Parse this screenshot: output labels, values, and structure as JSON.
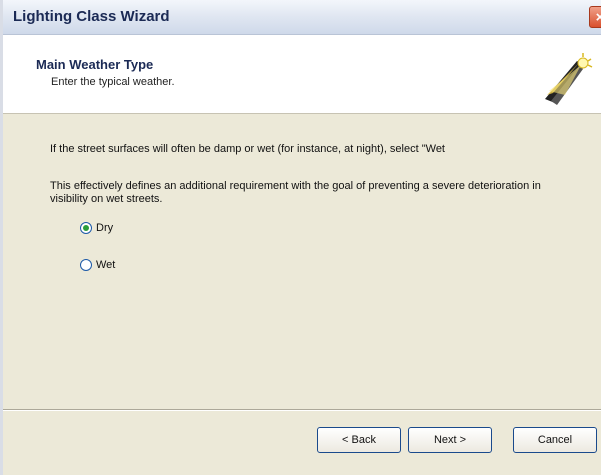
{
  "window": {
    "title": "Lighting Class Wizard",
    "close_symbol": "×"
  },
  "header": {
    "title": "Main Weather Type",
    "subtitle": "Enter the typical weather.",
    "icon": "wizard-lamp-icon"
  },
  "content": {
    "instruction": "If the street surfaces will often be damp or wet (for instance, at night), select \"Wet",
    "description": "This effectively defines an additional requirement with the goal of preventing a severe deterioration in visibility on wet streets.",
    "options": [
      {
        "label": "Dry",
        "selected": true
      },
      {
        "label": "Wet",
        "selected": false
      }
    ]
  },
  "buttons": {
    "back": "< Back",
    "next": "Next >",
    "cancel": "Cancel"
  },
  "colors": {
    "accent": "#1d5aa8",
    "dialog_bg": "#ece9d8",
    "title_text": "#1b2a55"
  }
}
